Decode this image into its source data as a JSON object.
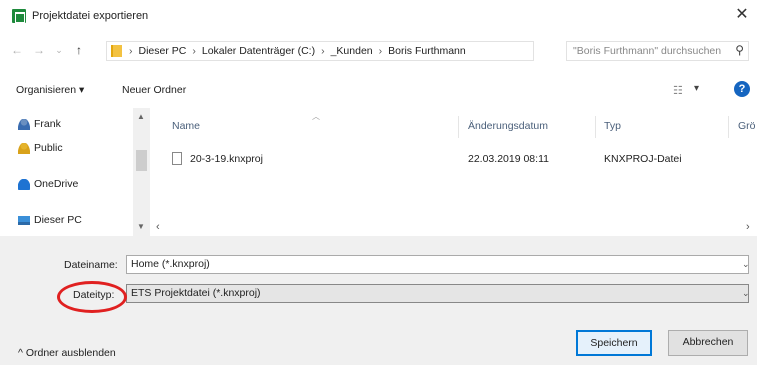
{
  "window": {
    "title": "Projektdatei exportieren"
  },
  "nav": {
    "back_icon": "arrow-left-icon",
    "forward_icon": "arrow-right-icon",
    "breadcrumbs": [
      "Dieser PC",
      "Lokaler Datenträger (C:)",
      "_Kunden",
      "Boris Furthmann"
    ],
    "search_placeholder": "\"Boris Furthmann\" durchsuchen"
  },
  "toolbar": {
    "organize_label": "Organisieren ▾",
    "new_folder_label": "Neuer Ordner"
  },
  "sidebar": {
    "items": [
      {
        "label": "Frank",
        "icon": "user-folder-icon"
      },
      {
        "label": "Public",
        "icon": "public-folder-icon"
      },
      {
        "label": "OneDrive",
        "icon": "onedrive-icon"
      },
      {
        "label": "Dieser PC",
        "icon": "computer-icon"
      }
    ]
  },
  "list": {
    "columns": [
      "Name",
      "Änderungsdatum",
      "Typ",
      "Grö"
    ],
    "rows": [
      {
        "name": "20-3-19.knxproj",
        "date": "22.03.2019 08:11",
        "type": "KNXPROJ-Datei"
      }
    ]
  },
  "form": {
    "filename_label": "Dateiname:",
    "filename_value": "Home (*.knxproj)",
    "filetype_label": "Dateityp:",
    "filetype_value": "ETS Projektdatei (*.knxproj)"
  },
  "footer": {
    "hide_folders_label": "^ Ordner ausblenden",
    "save_label": "Speichern",
    "cancel_label": "Abbrechen"
  },
  "colors": {
    "accent": "#0078d7",
    "annotation": "#e02020",
    "help": "#1565c0"
  }
}
